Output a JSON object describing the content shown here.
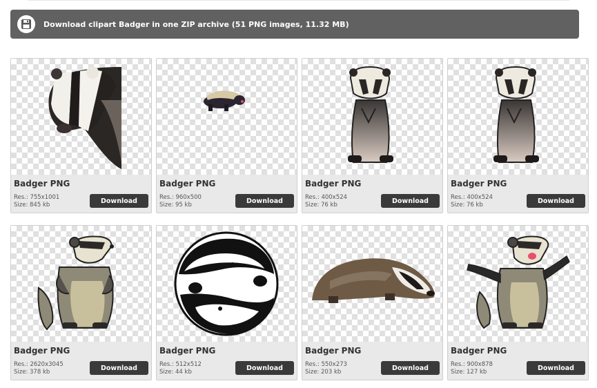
{
  "zip_banner": {
    "text": "Download clipart Badger in one ZIP archive (51 PNG images, 11.32 MB)",
    "icon": "floppy-disk-icon"
  },
  "cards": [
    {
      "title": "Badger PNG",
      "res": "Res.: 755x1001",
      "size": "Size: 845 kb",
      "button": "Download"
    },
    {
      "title": "Badger PNG",
      "res": "Res.: 960x500",
      "size": "Size: 95 kb",
      "button": "Download"
    },
    {
      "title": "Badger PNG",
      "res": "Res.: 400x524",
      "size": "Size: 76 kb",
      "button": "Download"
    },
    {
      "title": "Badger PNG",
      "res": "Res.: 400x524",
      "size": "Size: 76 kb",
      "button": "Download"
    },
    {
      "title": "Badger PNG",
      "res": "Res.: 2620x3045",
      "size": "Size: 378 kb",
      "button": "Download"
    },
    {
      "title": "Badger PNG",
      "res": "Res.: 512x512",
      "size": "Size: 44 kb",
      "button": "Download"
    },
    {
      "title": "Badger PNG",
      "res": "Res.: 550x273",
      "size": "Size: 203 kb",
      "button": "Download"
    },
    {
      "title": "Badger PNG",
      "res": "Res.: 900x878",
      "size": "Size: 127 kb",
      "button": "Download"
    }
  ],
  "colors": {
    "banner_bg": "#616161",
    "button_bg": "#3a3a3a",
    "card_bg": "#e9e9e9"
  }
}
